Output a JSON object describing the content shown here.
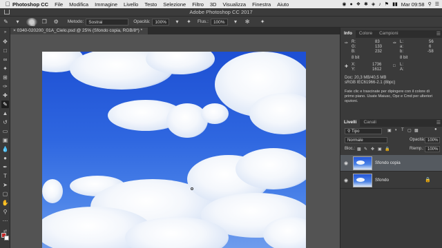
{
  "menubar": {
    "app_name": "Photoshop CC",
    "items": [
      "File",
      "Modifica",
      "Immagine",
      "Livello",
      "Testo",
      "Selezione",
      "Filtro",
      "3D",
      "Visualizza",
      "Finestra",
      "Aiuto"
    ],
    "clock": "Mar 09:58"
  },
  "window": {
    "title": "Adobe Photoshop CC 2017"
  },
  "options": {
    "brush_size": "48",
    "metodo_label": "Metodo:",
    "metodo_value": "Sostrai",
    "opacita_label": "Opacità:",
    "opacita_value": "100%",
    "flusso_label": "Flus.:",
    "flusso_value": "100%"
  },
  "document_tab": {
    "label": "0340-020200_01A_Cielo.psd @ 25% (Sfondo copia, RGB/8*) *"
  },
  "info_panel": {
    "tabs": [
      "Info",
      "Colore",
      "Campioni"
    ],
    "r_label": "R:",
    "r_value": "83",
    "g_label": "G:",
    "g_value": "133",
    "b_label": "B:",
    "b_value": "232",
    "l_label": "L:",
    "l_value": "56",
    "a_label": "a:",
    "a_value": "6",
    "bb_label": "b:",
    "bb_value": "-58",
    "bit_left": "8 bit",
    "bit_right": "8 bit",
    "x_label": "X:",
    "x_value": "1736",
    "y_label": "Y:",
    "y_value": "1612",
    "w_label": "L:",
    "h_label": "A:",
    "doc_size": "Doc: 20,3 MB/40,5 MB",
    "profile": "sRGB IEC61966-2.1 (8bpc)",
    "hint": "Fate clic e trascinate per dipingere con il colore di primo piano. Usate Maiusc, Opz e Cmd per ulteriori opzioni."
  },
  "layers_panel": {
    "tabs": [
      "Livelli",
      "Canali"
    ],
    "kind_value": "Tipo",
    "blend_value": "Normale",
    "opacity_label": "Opacità:",
    "opacity_value": "100%",
    "lock_label": "Bloc.:",
    "fill_label": "Riemp.:",
    "fill_value": "100%",
    "layers": [
      {
        "name": "Sfondo copia"
      },
      {
        "name": "Sfondo"
      }
    ]
  }
}
